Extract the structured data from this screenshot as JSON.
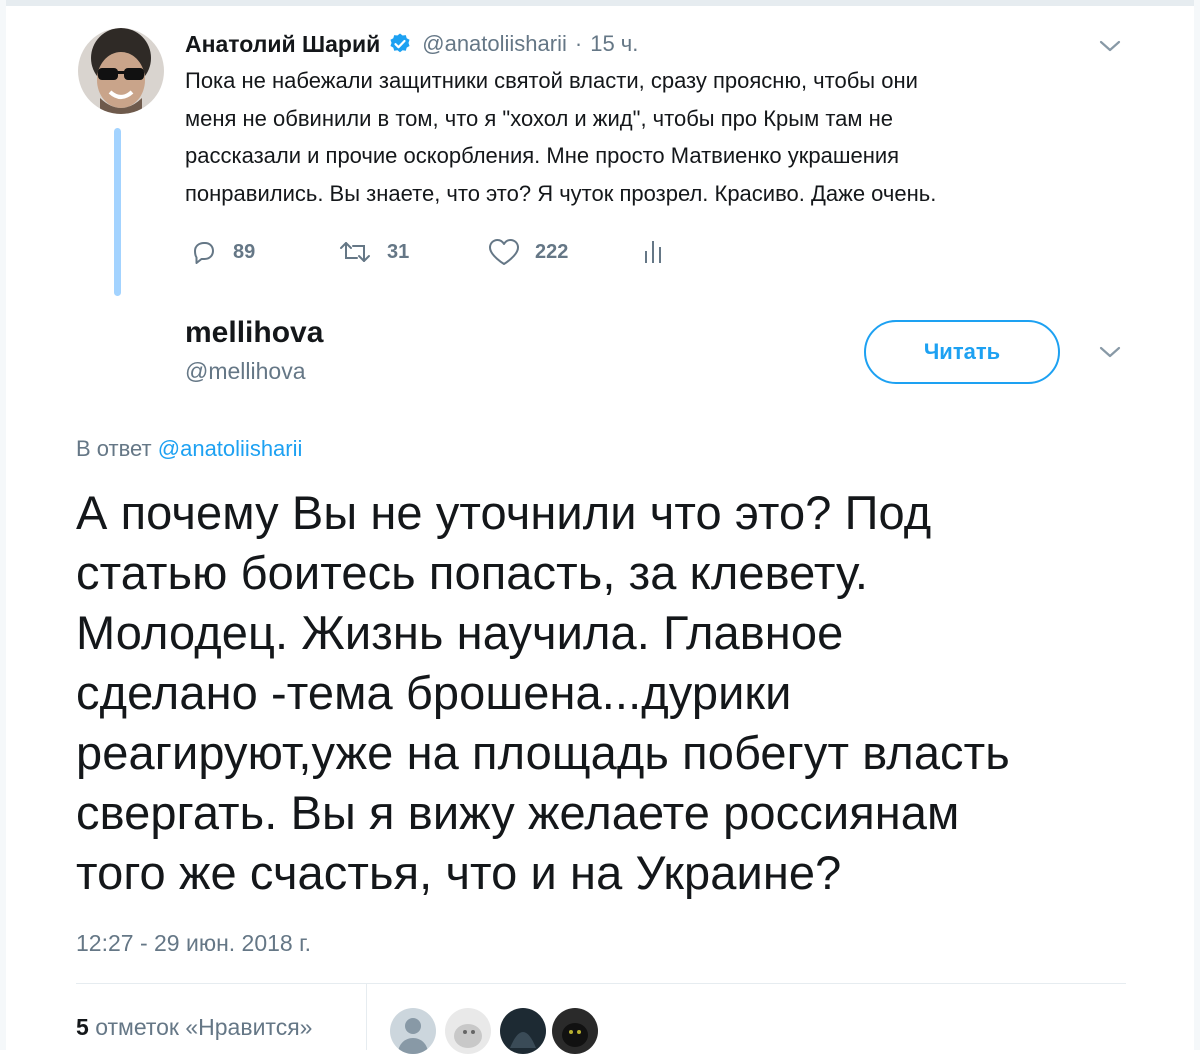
{
  "parent_tweet": {
    "author_name": "Анатолий Шарий",
    "handle": "@anatoliisharii",
    "separator": "·",
    "time_ago": "15 ч.",
    "text": "Пока не набежали защитники святой власти, сразу проясню, чтобы они\nменя не обвинили в том, что я \"хохол и жид\", чтобы про Крым там не\nрассказали и прочие оскорбления. Мне просто Матвиенко украшения\nпонравились. Вы знаете, что это? Я чуток прозрел. Красиво. Даже очень.",
    "replies": "89",
    "retweets": "31",
    "likes": "222"
  },
  "reply_tweet": {
    "author_name": "mellihova",
    "handle": "@mellihova",
    "follow_label": "Читать",
    "reply_to_prefix": "В ответ",
    "reply_to_handle": "@anatoliisharii",
    "text": "А почему Вы не уточнили что это? Под\nстатью боитесь попасть, за клевету.\nМолодец. Жизнь научила. Главное\nсделано -тема брошена...дурики\nреагируют,уже на площадь побегут власть\nсвергать. Вы я вижу желаете россиянам\nтого же счастья, что и на Украине?",
    "timestamp": "12:27 - 29 июн. 2018 г.",
    "like_count": "5",
    "like_label": "отметок «Нравится»"
  },
  "colors": {
    "accent": "#1da1f2",
    "secondary_text": "#657786",
    "thread_line": "#a3d3ff"
  }
}
